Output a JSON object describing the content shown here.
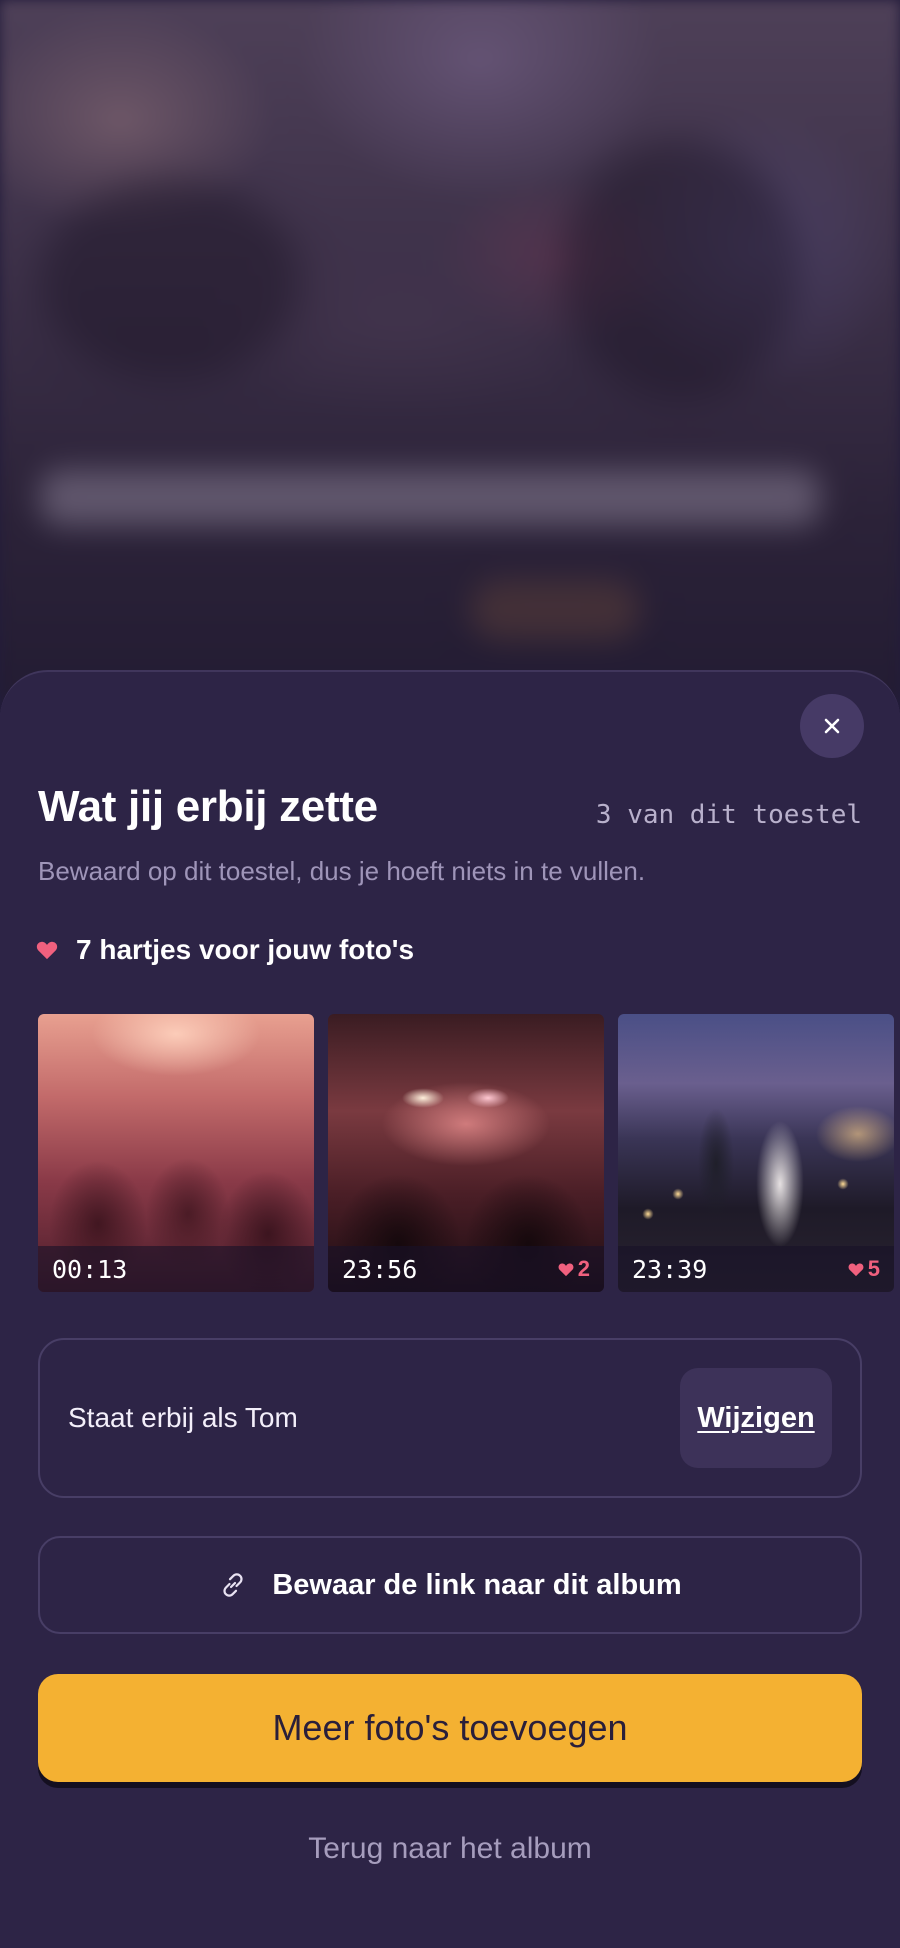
{
  "sheet": {
    "close_label": "×",
    "title": "Wat jij erbij zette",
    "device_count": "3 van dit toestel",
    "subtitle": "Bewaard op dit toestel, dus je hoeft niets in te vullen.",
    "hearts_label": "7 hartjes voor jouw foto's",
    "photos": [
      {
        "time": "00:13",
        "likes": ""
      },
      {
        "time": "23:56",
        "likes": "2"
      },
      {
        "time": "23:39",
        "likes": "5"
      }
    ],
    "name_text": "Staat erbij als Tom",
    "change_label": "Wijzigen",
    "link_label": "Bewaar de link naar dit album",
    "cta_label": "Meer foto's toevoegen",
    "back_label": "Terug naar het album"
  },
  "colors": {
    "sheet_bg": "#2d2446",
    "accent": "#f4b132",
    "heart": "#f0607e"
  },
  "icons": {
    "close": "close-icon",
    "heart": "heart-icon",
    "link": "link-icon"
  }
}
